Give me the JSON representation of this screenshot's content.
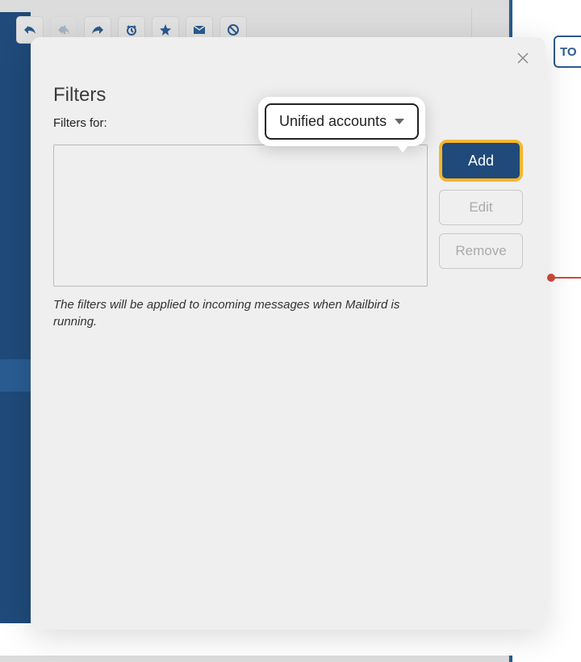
{
  "background": {
    "right_button_label": "TO"
  },
  "modal": {
    "title": "Filters",
    "filters_for_label": "Filters for:",
    "dropdown_selected": "Unified accounts",
    "add_label": "Add",
    "edit_label": "Edit",
    "remove_label": "Remove",
    "note": "The filters will be applied to incoming messages when Mailbird is running."
  }
}
